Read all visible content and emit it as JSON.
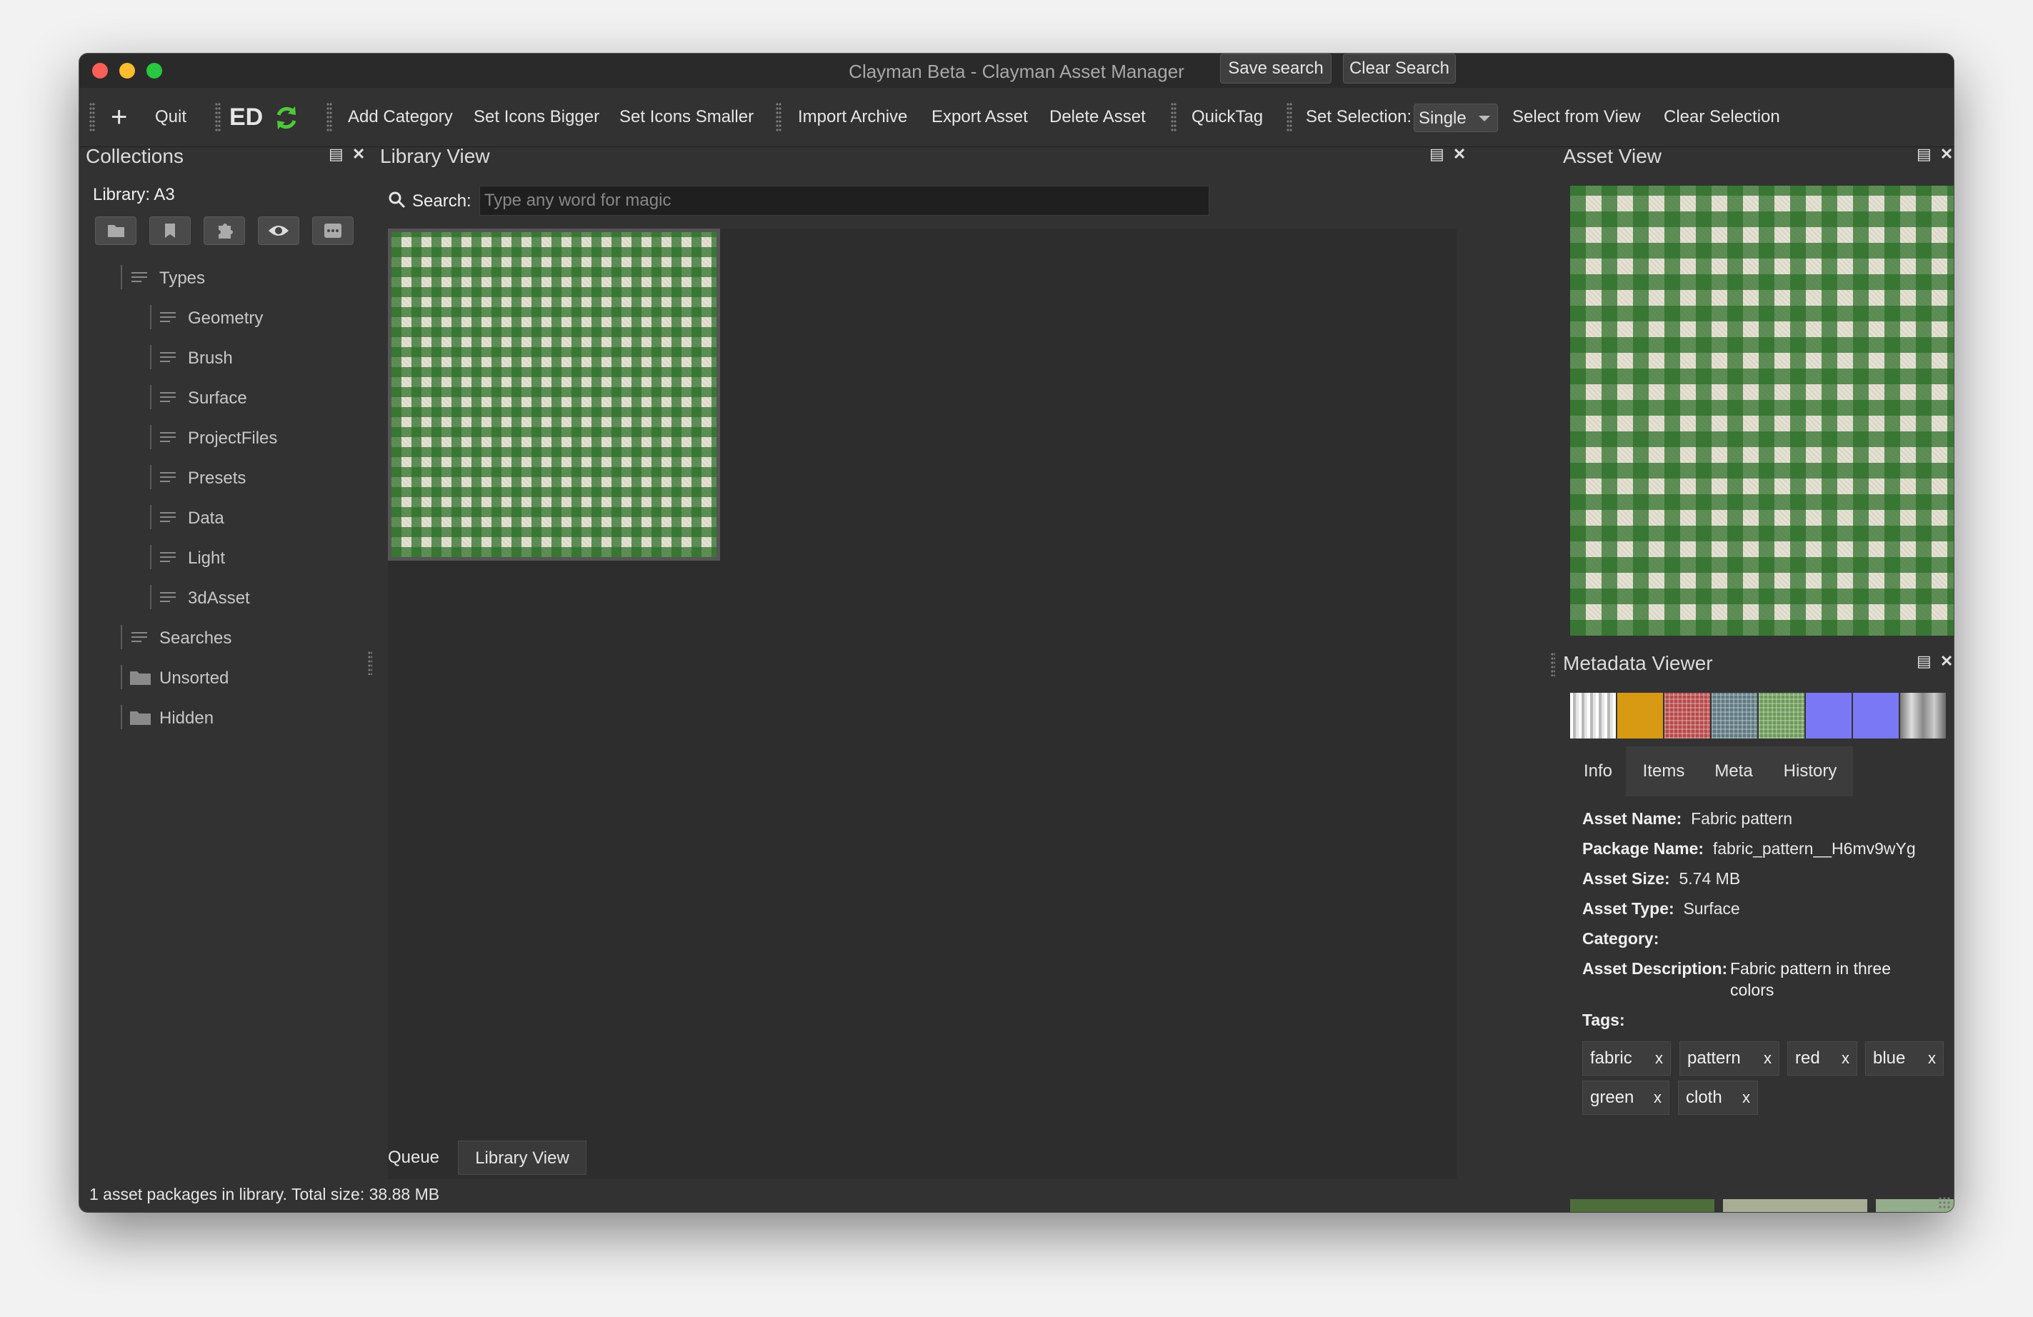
{
  "window": {
    "title": "Clayman Beta - Clayman Asset Manager"
  },
  "toolbar": {
    "quit": "Quit",
    "ed": "ED",
    "add_category": "Add Category",
    "set_icons_bigger": "Set Icons Bigger",
    "set_icons_smaller": "Set Icons Smaller",
    "import_archive": "Import Archive",
    "export_asset": "Export Asset",
    "delete_asset": "Delete Asset",
    "quicktag": "QuickTag",
    "set_selection_label": "Set Selection:",
    "set_selection_value": "Single",
    "select_from_view": "Select from View",
    "clear_selection": "Clear Selection"
  },
  "collections": {
    "title": "Collections",
    "library_label": "Library: A3",
    "tree": {
      "types": "Types",
      "children": [
        "Geometry",
        "Brush",
        "Surface",
        "ProjectFiles",
        "Presets",
        "Data",
        "Light",
        "3dAsset"
      ],
      "searches": "Searches",
      "unsorted": "Unsorted",
      "hidden": "Hidden"
    }
  },
  "library": {
    "title": "Library View",
    "search_label": "Search:",
    "search_placeholder": "Type any word for magic",
    "save_search": "Save search",
    "clear_search": "Clear Search",
    "tabs": [
      "Queue",
      "Library View"
    ]
  },
  "asset_view": {
    "title": "Asset View"
  },
  "metadata": {
    "title": "Metadata Viewer",
    "swatches": [
      "silver-stripes",
      "#d89a12",
      "red-weave",
      "blue-grey-weave",
      "green-weave",
      "#7b78f6",
      "#7b78f6",
      "grey-gradient"
    ],
    "tabs": [
      "Info",
      "Items",
      "Meta",
      "History"
    ],
    "asset_name_label": "Asset Name:",
    "asset_name": "Fabric pattern",
    "package_name_label": "Package Name:",
    "package_name": "fabric_pattern__H6mv9wYg",
    "asset_size_label": "Asset Size:",
    "asset_size": "5.74 MB",
    "asset_type_label": "Asset Type:",
    "asset_type": "Surface",
    "category_label": "Category:",
    "description_label": "Asset Description:",
    "description_line1": "Fabric pattern in three",
    "description_line2": "colors",
    "tags_label": "Tags:",
    "tags": [
      "fabric",
      "pattern",
      "red",
      "blue",
      "green",
      "cloth"
    ],
    "tag_remove": "x",
    "palette": [
      "#4d6e3a",
      "#a7ae94",
      "#94ad8c"
    ]
  },
  "status": "1 asset packages in library. Total size: 38.88 MB"
}
